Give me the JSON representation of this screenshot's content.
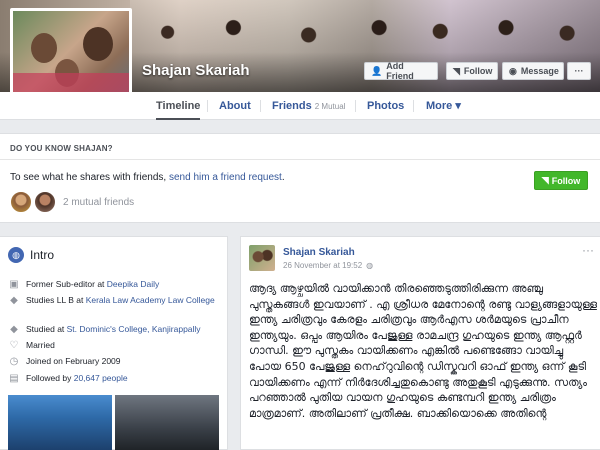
{
  "profile": {
    "name": "Shajan Skariah",
    "actions": {
      "add_friend": "Add Friend",
      "follow": "Follow",
      "message": "Message",
      "more": "···"
    }
  },
  "nav": {
    "timeline": "Timeline",
    "about": "About",
    "friends": "Friends",
    "friends_count": "2 Mutual",
    "photos": "Photos",
    "more": "More ▾"
  },
  "know": {
    "heading": "DO YOU KNOW SHAJAN?",
    "text_prefix": "To see what he shares with friends, ",
    "link": "send him a friend request",
    "text_suffix": ".",
    "follow_button": "Follow",
    "mutual_friends": "2 mutual friends"
  },
  "intro": {
    "title": "Intro",
    "rows": [
      {
        "icon": "briefcase-icon",
        "text": "Former Sub-editor at ",
        "link": "Deepika Daily"
      },
      {
        "icon": "graduation-cap-icon",
        "text": "Studies LL B at ",
        "link": "Kerala Law Academy Law College"
      },
      {
        "icon": "graduation-cap-icon",
        "text": "Studied at ",
        "link": "St. Dominic's College, Kanjirappally"
      },
      {
        "icon": "heart-icon",
        "text": "Married",
        "link": ""
      },
      {
        "icon": "clock-icon",
        "text": "Joined on February 2009",
        "link": ""
      },
      {
        "icon": "followers-icon",
        "text": "Followed by ",
        "link": "20,647 people"
      }
    ]
  },
  "post": {
    "author": "Shajan Skariah",
    "time": "26 November at 19:52",
    "body": "ആദ്യ ആഴ്ചയിൽ വായിക്കാൻ തിരഞ്ഞെടുത്തിരിക്കുന്ന അഞ്ചു പുസ്തകങ്ങൾ ഇവയാണ് . എ ശ്രീധര മേനോന്റെ രണ്ടു വാള്യങ്ങളായുള്ള ഇന്ത്യ ചരിത്രവും കേരളം ചരിത്രവും ആർഎസ ശർമയുടെ പ്രാചീന ഇന്ത്യയും. ഒപ്പം ആയിരം പേജുള്ള രാമചന്ദ്ര ഗുഹയുടെ ഇന്ത്യ ആഫ്റ്റർ ഗാന്ധി. ഈ പുസ്തകം വായിക്കണം എങ്കിൽ പണ്ടെങ്ങോ വായിച്ചു പോയ 650 പേജുള്ള നെഹ്‌റുവിന്റെ ഡിസ്കവറി ഓഫ് ഇന്ത്യ ഒന്ന് കൂടി വായിക്കണം എന്ന് നിർദേശിച്ചതുകൊണ്ടു അതുകൂടി എടുക്കുന്നു. സത്യം പറഞ്ഞാൽ പുതിയ വായന ഗുഹയുടെ കണ്ടമ്പറി ഇന്ത്യ ചരിത്രം മാത്രമാണ്. അതിലാണ് പ്രതീക്ഷ. ബാക്കിയൊക്കെ അതിന്റെ"
  }
}
